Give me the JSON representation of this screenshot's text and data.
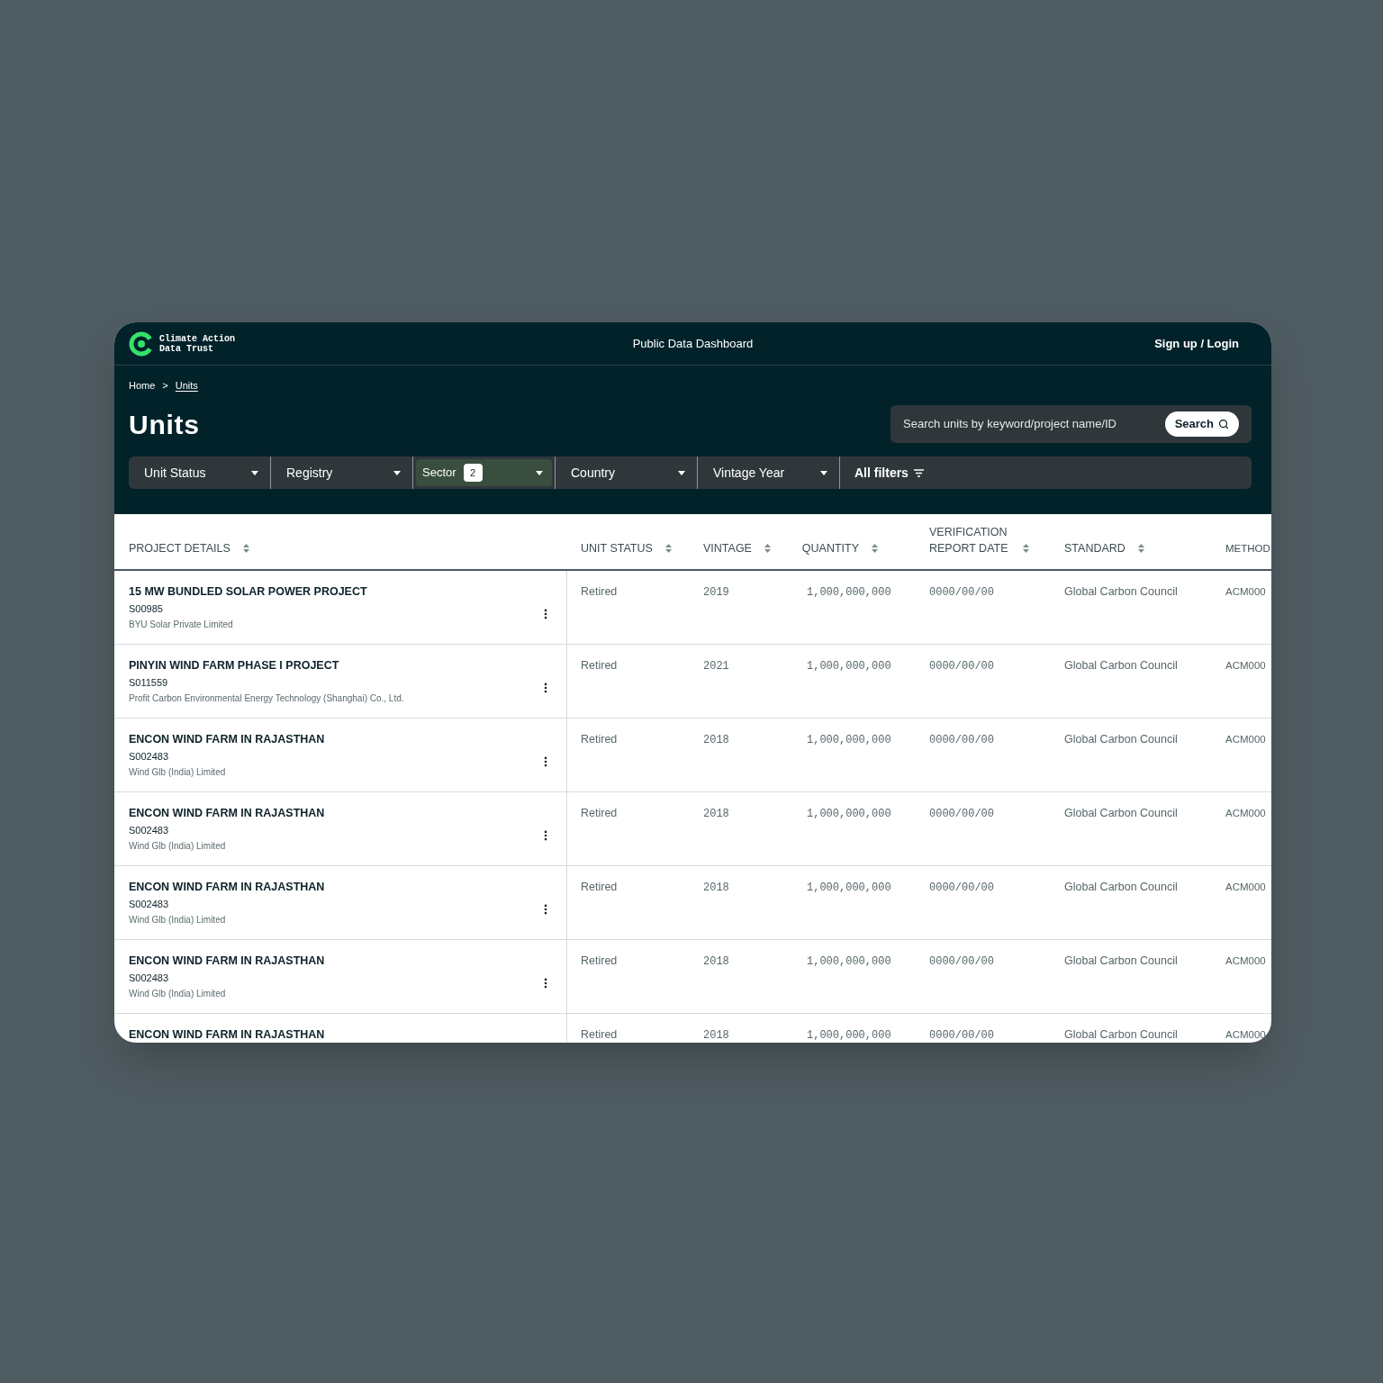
{
  "header": {
    "logo_lines": [
      "Climate Action",
      "Data Trust"
    ],
    "title": "Public Data Dashboard",
    "auth_link": "Sign up / Login"
  },
  "breadcrumb": {
    "separator": ">",
    "items": [
      {
        "label": "Home",
        "current": false
      },
      {
        "label": "Units",
        "current": true
      }
    ]
  },
  "page_title": "Units",
  "search": {
    "placeholder": "Search units by keyword/project name/ID",
    "button": "Search"
  },
  "filters": [
    {
      "label": "Unit Status",
      "selected": false
    },
    {
      "label": "Registry",
      "selected": false
    },
    {
      "label": "Sector",
      "selected": true,
      "count": "2"
    },
    {
      "label": "Country",
      "selected": false
    },
    {
      "label": "Vintage Year",
      "selected": false
    }
  ],
  "all_filters": "All filters",
  "table": {
    "columns": [
      {
        "label": "PROJECT DETAILS",
        "sortable": true
      },
      {
        "label": "UNIT STATUS",
        "sortable": true
      },
      {
        "label": "VINTAGE",
        "sortable": true
      },
      {
        "label": "QUANTITY",
        "sortable": true
      },
      {
        "label": "VERIFICATION REPORT DATE",
        "sortable": true
      },
      {
        "label": "STANDARD",
        "sortable": true
      },
      {
        "label": "METHOD",
        "sortable": false
      }
    ],
    "rows": [
      {
        "name": "15 MW BUNDLED SOLAR POWER PROJECT",
        "id": "S00985",
        "company": "BYU Solar Private Limited",
        "status": "Retired",
        "vintage": "2019",
        "quantity": "1,000,000,000",
        "report_date": "0000/00/00",
        "standard": "Global Carbon Council",
        "method": "ACM000"
      },
      {
        "name": "PINYIN WIND FARM PHASE I PROJECT",
        "id": "S011559",
        "company": "Profit Carbon Environmental Energy Technology (Shanghai) Co., Ltd.",
        "status": "Retired",
        "vintage": "2021",
        "quantity": "1,000,000,000",
        "report_date": "0000/00/00",
        "standard": "Global Carbon Council",
        "method": "ACM000"
      },
      {
        "name": "ENCON WIND FARM IN RAJASTHAN",
        "id": "S002483",
        "company": "Wind Glb (India) Limited",
        "status": "Retired",
        "vintage": "2018",
        "quantity": "1,000,000,000",
        "report_date": "0000/00/00",
        "standard": "Global Carbon Council",
        "method": "ACM000"
      },
      {
        "name": "ENCON WIND FARM IN RAJASTHAN",
        "id": "S002483",
        "company": "Wind Glb (India) Limited",
        "status": "Retired",
        "vintage": "2018",
        "quantity": "1,000,000,000",
        "report_date": "0000/00/00",
        "standard": "Global Carbon Council",
        "method": "ACM000"
      },
      {
        "name": "ENCON WIND FARM IN RAJASTHAN",
        "id": "S002483",
        "company": "Wind Glb (India) Limited",
        "status": "Retired",
        "vintage": "2018",
        "quantity": "1,000,000,000",
        "report_date": "0000/00/00",
        "standard": "Global Carbon Council",
        "method": "ACM000"
      },
      {
        "name": "ENCON WIND FARM IN RAJASTHAN",
        "id": "S002483",
        "company": "Wind Glb (India) Limited",
        "status": "Retired",
        "vintage": "2018",
        "quantity": "1,000,000,000",
        "report_date": "0000/00/00",
        "standard": "Global Carbon Council",
        "method": "ACM000"
      },
      {
        "name": "ENCON WIND FARM IN RAJASTHAN",
        "status": "Retired",
        "vintage": "2018",
        "quantity": "1,000,000,000",
        "report_date": "0000/00/00",
        "standard": "Global Carbon Council",
        "method": "ACM000"
      }
    ]
  }
}
